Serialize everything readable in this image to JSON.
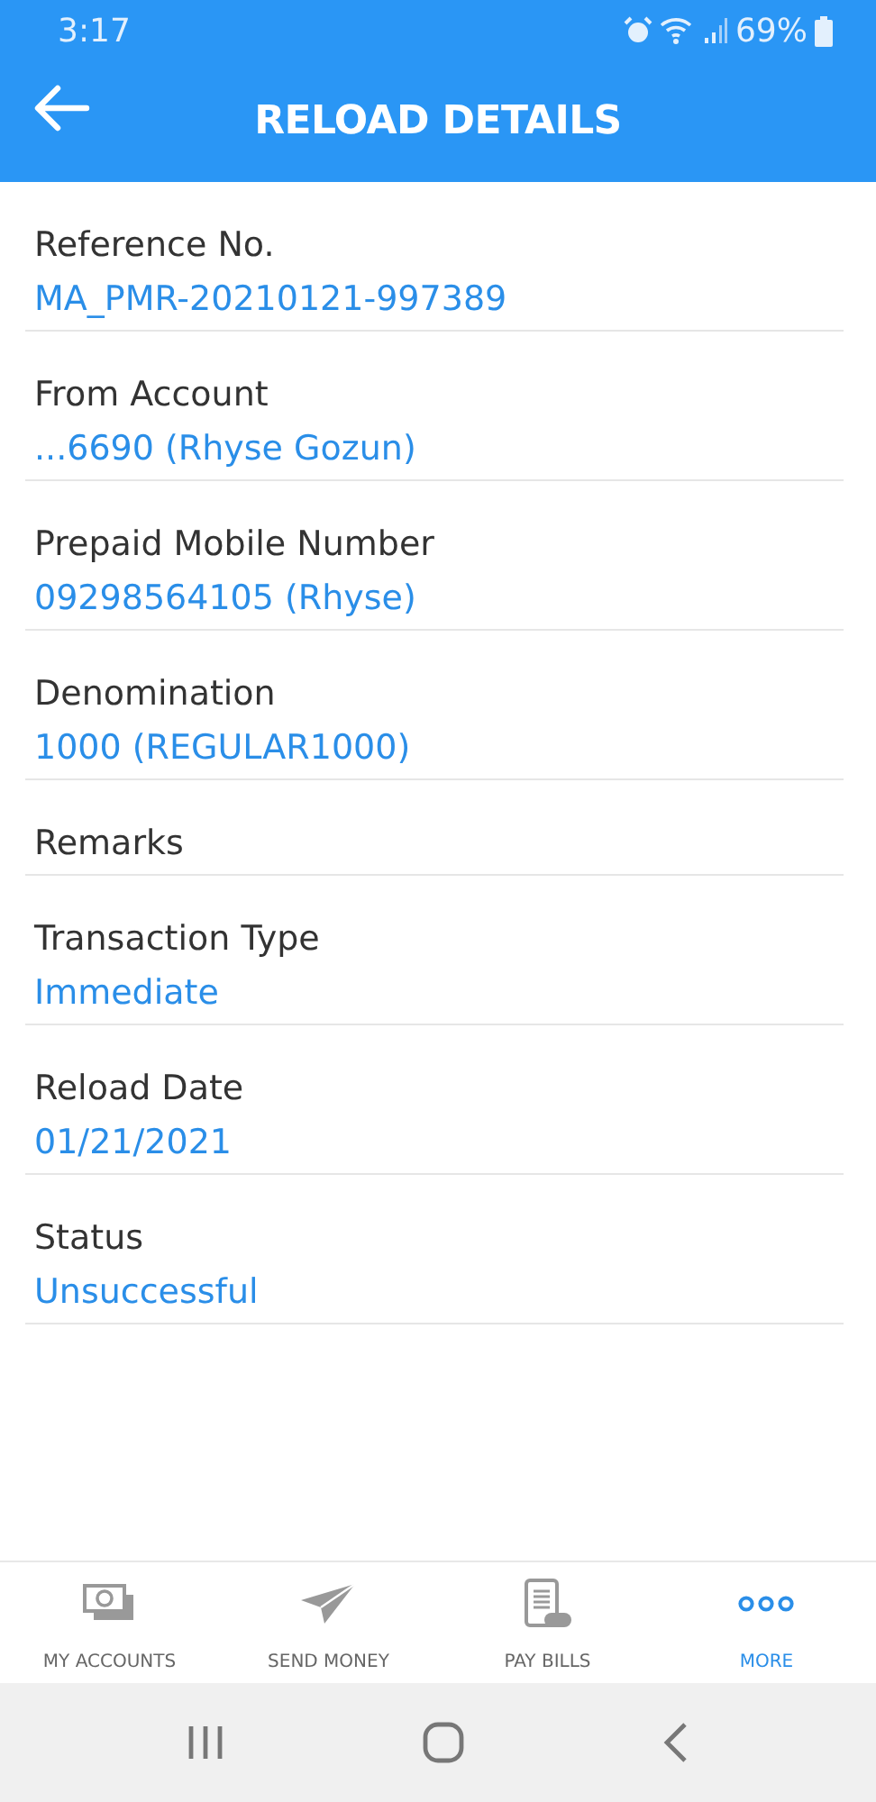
{
  "status_bar": {
    "time": "3:17",
    "battery": "69%"
  },
  "header": {
    "title": "RELOAD DETAILS"
  },
  "fields": [
    {
      "label": "Reference No.",
      "value": "MA_PMR-20210121-997389"
    },
    {
      "label": "From Account",
      "value": "...6690 (Rhyse Gozun)"
    },
    {
      "label": "Prepaid Mobile Number",
      "value": "09298564105 (Rhyse)"
    },
    {
      "label": "Denomination",
      "value": "1000 (REGULAR1000)"
    },
    {
      "label": "Remarks"
    },
    {
      "label": "Transaction Type",
      "value": "Immediate"
    },
    {
      "label": "Reload Date",
      "value": "01/21/2021"
    },
    {
      "label": "Status",
      "value": "Unsuccessful"
    }
  ],
  "bottom_nav": [
    {
      "label": "MY ACCOUNTS",
      "kind": "accounts",
      "selected": false
    },
    {
      "label": "SEND MONEY",
      "kind": "send",
      "selected": false
    },
    {
      "label": "PAY BILLS",
      "kind": "bills",
      "selected": false
    },
    {
      "label": "MORE",
      "kind": "more",
      "selected": true
    }
  ]
}
